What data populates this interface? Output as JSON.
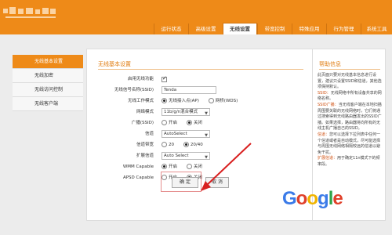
{
  "nav": {
    "tabs": [
      "运行状态",
      "高级设置",
      "无线设置",
      "带宽控制",
      "特殊应用",
      "行为管理",
      "系统工具"
    ],
    "active_tab": 2
  },
  "sidebar": {
    "items": [
      {
        "label": "无线基本设置",
        "active": true
      },
      {
        "label": "无线加密",
        "active": false
      },
      {
        "label": "无线访问控制",
        "active": false
      },
      {
        "label": "无线客户端",
        "active": false
      }
    ]
  },
  "form": {
    "title": "无线基本设置",
    "enable_label": "启用无线功能",
    "enable_checked": true,
    "ssid_label": "无线信号名称(SSID)",
    "ssid_value": "Tenda",
    "mode_label": "无线工作模式",
    "mode_options": [
      "无线接入点(AP)",
      "网桥(WDS)"
    ],
    "mode_selected": 0,
    "netmode_label": "网络模式",
    "netmode_value": "11b/g/n混合模式",
    "broadcast_label": "广播(SSID)",
    "broadcast_options": [
      "开启",
      "关闭"
    ],
    "broadcast_selected": 1,
    "channel_label": "信道",
    "channel_value": "AutoSelect",
    "bandwidth_label": "信道带宽",
    "bandwidth_options": [
      "20",
      "20/40"
    ],
    "bandwidth_selected": 1,
    "ext_channel_label": "扩展信道",
    "ext_channel_value": "Auto Select",
    "wmm_label": "WMM Capable",
    "wmm_options": [
      "开启",
      "关闭"
    ],
    "wmm_selected": 0,
    "apsd_label": "APSD Capable",
    "apsd_options": [
      "开启",
      "关闭"
    ],
    "apsd_selected": 1,
    "ok_label": "确 定",
    "cancel_label": "取 消"
  },
  "help": {
    "title": "帮助信息",
    "intro": "此页面只要对无线基本信息进行设置，建议只设置SSID和信道，其他选项保持默认。",
    "p1_key": "SSID：",
    "p1": "无线网络中所有设备共享的网络名称。",
    "p2_key": "SSID广播：",
    "p2": "当无线客户端在本地扫描周围要关联的无线网络时，它们将通过搜索得到无线路由器发出的SSID广播。如果选择，路由器将向所有的无线主机广播自己的SSID。",
    "p3_key": "信道：",
    "p3": "您可以选择下拉列表中任何一个信道或者是自动模式，尽可能选择与周围无线网络相隔较远的信道以避免干扰。",
    "p4_key": "扩展信道：",
    "p4": "用于确定11n模式下的频率段。"
  },
  "watermark": {
    "letters": [
      "G",
      "o",
      "o",
      "g",
      "l",
      "e"
    ],
    "colors": [
      "#3b7be8",
      "#e0402a",
      "#f0b400",
      "#3b7be8",
      "#2fa54a",
      "#e0402a"
    ]
  }
}
